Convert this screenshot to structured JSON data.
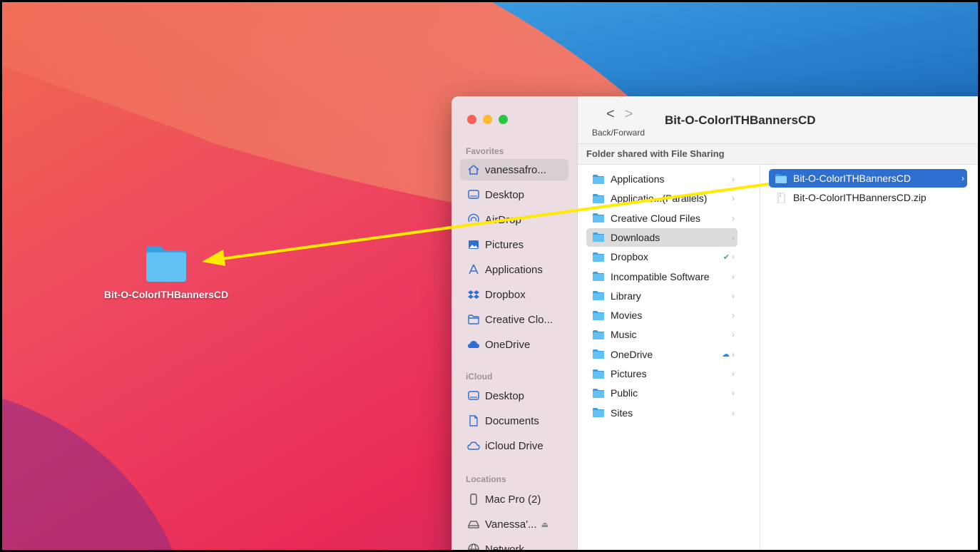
{
  "desktop": {
    "folder_label": "Bit-O-ColorITHBannersCD",
    "folder_icon": "folder-icon"
  },
  "finder": {
    "title": "Bit-O-ColorITHBannersCD",
    "nav_caption": "Back/Forward",
    "back_glyph": "<",
    "forward_glyph": ">",
    "path_caption": "Folder shared with File Sharing",
    "sidebar": {
      "favorites_heading": "Favorites",
      "favorites": [
        {
          "label": "vanessafro...",
          "icon": "home-icon",
          "selected": true
        },
        {
          "label": "Desktop",
          "icon": "desktop-icon"
        },
        {
          "label": "AirDrop",
          "icon": "airdrop-icon"
        },
        {
          "label": "Pictures",
          "icon": "pictures-icon"
        },
        {
          "label": "Applications",
          "icon": "applications-icon"
        },
        {
          "label": "Dropbox",
          "icon": "dropbox-icon"
        },
        {
          "label": "Creative Clo...",
          "icon": "folder-outline-icon"
        },
        {
          "label": "OneDrive",
          "icon": "cloud-icon"
        }
      ],
      "icloud_heading": "iCloud",
      "icloud": [
        {
          "label": "Desktop",
          "icon": "desktop-icon"
        },
        {
          "label": "Documents",
          "icon": "document-icon"
        },
        {
          "label": "iCloud Drive",
          "icon": "icloud-icon"
        }
      ],
      "locations_heading": "Locations",
      "locations": [
        {
          "label": "Mac Pro (2)",
          "icon": "mac-pro-icon"
        },
        {
          "label": "Vanessa'...",
          "icon": "drive-icon",
          "eject": "⏏"
        },
        {
          "label": "Network",
          "icon": "network-icon"
        }
      ]
    },
    "column1": [
      {
        "label": "Applications",
        "icon": "folder-icon"
      },
      {
        "label": "Applicatio...(Parallels)",
        "icon": "folder-icon"
      },
      {
        "label": "Creative Cloud Files",
        "icon": "folder-icon"
      },
      {
        "label": "Downloads",
        "icon": "folder-icon",
        "selected": true
      },
      {
        "label": "Dropbox",
        "icon": "folder-icon",
        "badge": "✔",
        "badge_color": "#3fb34f"
      },
      {
        "label": "Incompatible Software",
        "icon": "folder-icon"
      },
      {
        "label": "Library",
        "icon": "folder-icon"
      },
      {
        "label": "Movies",
        "icon": "folder-icon"
      },
      {
        "label": "Music",
        "icon": "folder-icon"
      },
      {
        "label": "OneDrive",
        "icon": "folder-icon",
        "badge": "☁",
        "badge_color": "#2d8ce0"
      },
      {
        "label": "Pictures",
        "icon": "folder-icon"
      },
      {
        "label": "Public",
        "icon": "folder-icon"
      },
      {
        "label": "Sites",
        "icon": "folder-icon"
      }
    ],
    "column2": [
      {
        "label": "Bit-O-ColorITHBannersCD",
        "icon": "folder-icon",
        "active": true,
        "chevron": true
      },
      {
        "label": "Bit-O-ColorITHBannersCD.zip",
        "icon": "zip-file-icon"
      }
    ],
    "chevron_glyph": "›"
  },
  "colors": {
    "accent": "#2f6fcf",
    "folder": "#5bb8f0",
    "arrow": "#ffea00",
    "close": "#ff5f57",
    "minimize": "#febc2e",
    "zoom": "#28c840"
  }
}
